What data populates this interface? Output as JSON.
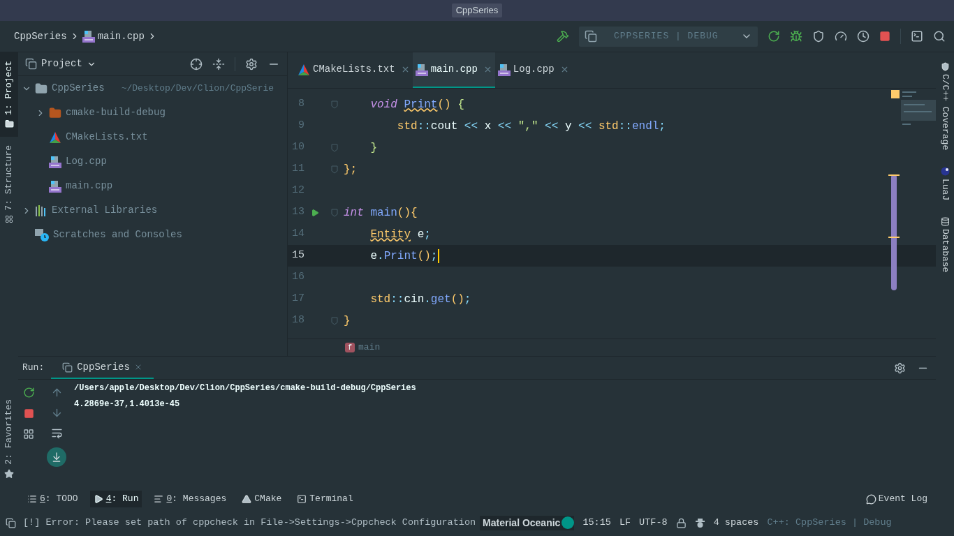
{
  "title": "CppSeries",
  "breadcrumb": [
    {
      "label": "CppSeries",
      "kind": "project"
    },
    {
      "label": "main.cpp",
      "kind": "cpp"
    }
  ],
  "run_config": "CPPSERIES | DEBUG",
  "left_tabs": [
    {
      "label": "1: Project",
      "kind": "folder",
      "selected": true
    },
    {
      "label": "7: Structure",
      "kind": "structure",
      "selected": false
    }
  ],
  "favorites_tab": {
    "label": "2: Favorites",
    "selected": false
  },
  "project_panel": {
    "title": "Project",
    "tree": [
      {
        "label": "CppSeries",
        "path": "~/Desktop/Dev/Clion/CppSerie",
        "kind": "folder",
        "expanded": true,
        "children": [
          {
            "label": "cmake-build-debug",
            "kind": "build-folder",
            "expanded": false
          },
          {
            "label": "CMakeLists.txt",
            "kind": "cmake"
          },
          {
            "label": "Log.cpp",
            "kind": "cpp"
          },
          {
            "label": "main.cpp",
            "kind": "cpp"
          }
        ]
      },
      {
        "label": "External Libraries",
        "kind": "libraries",
        "expanded": false
      },
      {
        "label": "Scratches and Consoles",
        "kind": "scratches"
      }
    ]
  },
  "editor_tabs": [
    {
      "label": "CMakeLists.txt",
      "kind": "cmake",
      "selected": false
    },
    {
      "label": "main.cpp",
      "kind": "cpp",
      "selected": true
    },
    {
      "label": "Log.cpp",
      "kind": "cpp",
      "selected": false
    }
  ],
  "code_lines": [
    {
      "number": "8",
      "current": false,
      "run_marker": false,
      "fold": true,
      "tokens": [
        {
          "text": "    void ",
          "kind": "keyword",
          "warning": false
        },
        {
          "text": "Print",
          "kind": "function",
          "warning": true
        },
        {
          "text": "() ",
          "kind": "bracket",
          "warning": false
        },
        {
          "text": "{",
          "kind": "brace",
          "warning": false
        }
      ]
    },
    {
      "number": "9",
      "current": false,
      "run_marker": false,
      "fold": false,
      "tokens": [
        {
          "text": "        std",
          "kind": "type",
          "warning": false
        },
        {
          "text": "::",
          "kind": "operator",
          "warning": false
        },
        {
          "text": "cout ",
          "kind": "plain",
          "warning": false
        },
        {
          "text": "<< ",
          "kind": "operator",
          "warning": false
        },
        {
          "text": "x ",
          "kind": "plain",
          "warning": false
        },
        {
          "text": "<< ",
          "kind": "operator",
          "warning": false
        },
        {
          "text": "\",\" ",
          "kind": "string",
          "warning": false
        },
        {
          "text": "<< ",
          "kind": "operator",
          "warning": false
        },
        {
          "text": "y ",
          "kind": "plain",
          "warning": false
        },
        {
          "text": "<< ",
          "kind": "operator",
          "warning": false
        },
        {
          "text": "std",
          "kind": "type",
          "warning": false
        },
        {
          "text": "::",
          "kind": "operator",
          "warning": false
        },
        {
          "text": "endl",
          "kind": "function",
          "warning": false
        },
        {
          "text": ";",
          "kind": "operator",
          "warning": false
        }
      ]
    },
    {
      "number": "10",
      "current": false,
      "run_marker": false,
      "fold": true,
      "tokens": [
        {
          "text": "    }",
          "kind": "brace",
          "warning": false
        }
      ]
    },
    {
      "number": "11",
      "current": false,
      "run_marker": false,
      "fold": true,
      "tokens": [
        {
          "text": "};",
          "kind": "bracket",
          "warning": false
        }
      ]
    },
    {
      "number": "12",
      "current": false,
      "run_marker": false,
      "fold": false
    },
    {
      "number": "13",
      "current": false,
      "run_marker": true,
      "fold": true,
      "tokens": [
        {
          "text": "int ",
          "kind": "keyword",
          "warning": false
        },
        {
          "text": "main",
          "kind": "function",
          "warning": false
        },
        {
          "text": "(){",
          "kind": "bracket",
          "warning": false
        }
      ]
    },
    {
      "number": "14",
      "current": false,
      "run_marker": false,
      "fold": false,
      "tokens": [
        {
          "text": "    Entity",
          "kind": "type",
          "warning": true
        },
        {
          "text": " e",
          "kind": "plain",
          "warning": false
        },
        {
          "text": ";",
          "kind": "operator",
          "warning": false
        }
      ]
    },
    {
      "number": "15",
      "current": true,
      "run_marker": false,
      "fold": false,
      "tokens": [
        {
          "text": "    e",
          "kind": "plain",
          "warning": false
        },
        {
          "text": ".",
          "kind": "operator",
          "warning": false
        },
        {
          "text": "Print",
          "kind": "function",
          "warning": false
        },
        {
          "text": "()",
          "kind": "bracket",
          "warning": false
        },
        {
          "text": ";",
          "kind": "operator",
          "warning": false
        }
      ]
    },
    {
      "number": "16",
      "current": false,
      "run_marker": false,
      "fold": false
    },
    {
      "number": "17",
      "current": false,
      "run_marker": false,
      "fold": false,
      "tokens": [
        {
          "text": "    std",
          "kind": "type",
          "warning": false
        },
        {
          "text": "::",
          "kind": "operator",
          "warning": false
        },
        {
          "text": "cin",
          "kind": "plain",
          "warning": false
        },
        {
          "text": ".",
          "kind": "operator",
          "warning": false
        },
        {
          "text": "get",
          "kind": "function",
          "warning": false
        },
        {
          "text": "()",
          "kind": "bracket",
          "warning": false
        },
        {
          "text": ";",
          "kind": "operator",
          "warning": false
        }
      ]
    },
    {
      "number": "18",
      "current": false,
      "run_marker": false,
      "fold": true,
      "tokens": [
        {
          "text": "}",
          "kind": "bracket",
          "warning": false
        }
      ]
    }
  ],
  "code_breadcrumb": {
    "badge": "f",
    "label": "main"
  },
  "right_tabs": [
    {
      "label": "C/C++ Coverage",
      "kind": "shield"
    },
    {
      "label": "LuaJ",
      "kind": "lua"
    },
    {
      "label": "Database",
      "kind": "database"
    }
  ],
  "run_panel": {
    "label": "Run:",
    "tab": {
      "label": "CppSeries",
      "selected": true
    },
    "output": [
      "/Users/apple/Desktop/Dev/Clion/CppSeries/cmake-build-debug/CppSeries",
      "4.2869e-37,1.4013e-45"
    ]
  },
  "tool_tabs": [
    {
      "mnemonic": "6",
      "label": ": TODO",
      "kind": "list",
      "selected": false
    },
    {
      "mnemonic": "4",
      "label": ": Run",
      "kind": "run",
      "selected": true
    },
    {
      "mnemonic": "0",
      "label": ": Messages",
      "kind": "messages",
      "selected": false
    },
    {
      "label": "CMake",
      "kind": "cmake",
      "selected": false
    },
    {
      "label": "Terminal",
      "kind": "terminal",
      "selected": false
    }
  ],
  "event_log": "Event Log",
  "status_bar": {
    "message": "[!] Error: Please set path of cppcheck in File->Settings->Cppcheck Configuration",
    "theme": "Material Oceanic",
    "position": "15:15",
    "line_separator": "LF",
    "encoding": "UTF-8",
    "indent": "4 spaces",
    "context": "C++: CppSeries | Debug"
  }
}
